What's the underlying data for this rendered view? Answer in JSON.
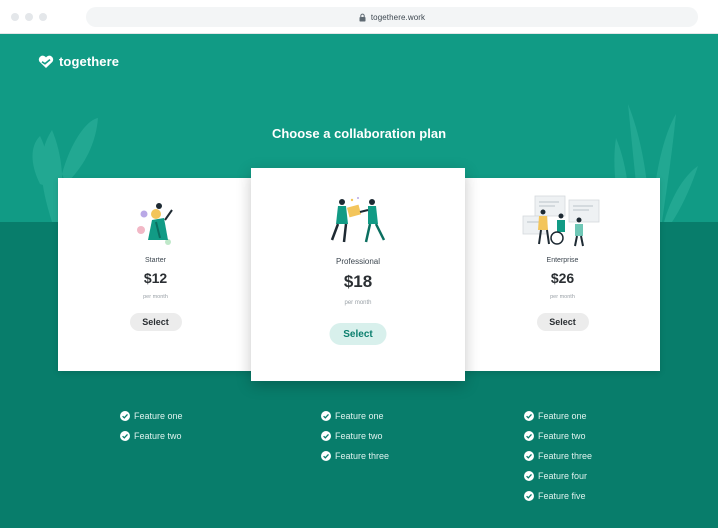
{
  "browser": {
    "url": "togethere.work"
  },
  "brand": {
    "name": "togethere"
  },
  "page": {
    "title": "Choose a collaboration plan"
  },
  "colors": {
    "accent": "#119b85",
    "dark": "#087d6b",
    "button_featured": "#d8f0ec"
  },
  "plans": [
    {
      "name": "Starter",
      "price": "$12",
      "period": "per month",
      "select_label": "Select",
      "features": [
        "Feature one",
        "Feature two"
      ]
    },
    {
      "name": "Professional",
      "price": "$18",
      "period": "per month",
      "select_label": "Select",
      "features": [
        "Feature one",
        "Feature two",
        "Feature three"
      ]
    },
    {
      "name": "Enterprise",
      "price": "$26",
      "period": "per month",
      "select_label": "Select",
      "features": [
        "Feature one",
        "Feature two",
        "Feature three",
        "Feature four",
        "Feature five"
      ]
    }
  ]
}
